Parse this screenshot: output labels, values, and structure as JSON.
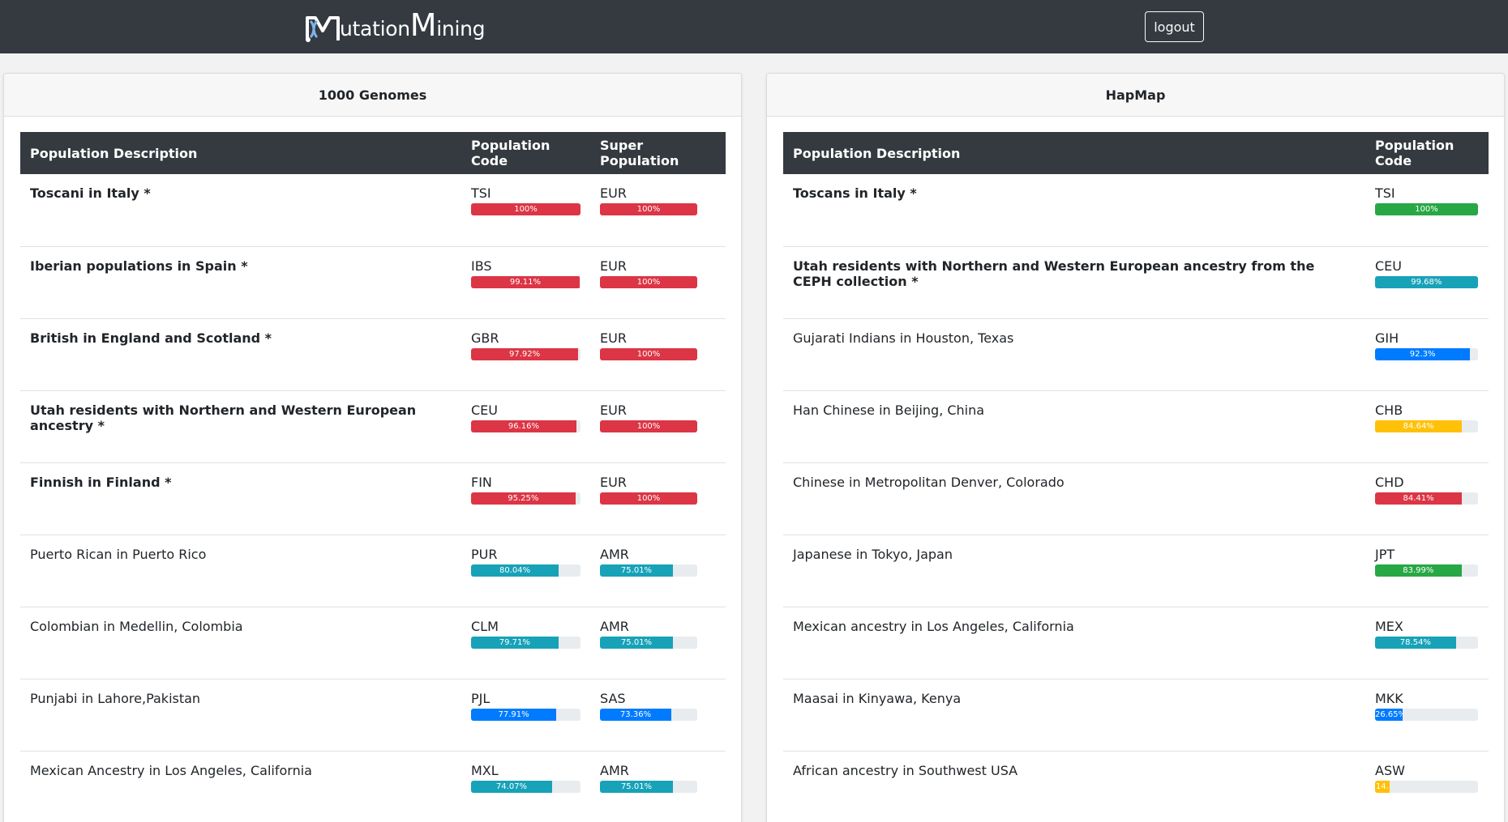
{
  "navbar": {
    "brand_first": "utation",
    "brand_big": "M",
    "brand_second": "ining",
    "logout_label": "logout"
  },
  "colors": {
    "navbar": "#343a40",
    "danger": "#dc3545",
    "info": "#17a2b8",
    "primary": "#007bff",
    "warning": "#ffc107",
    "success": "#28a745"
  },
  "genomes": {
    "title": "1000 Genomes",
    "headers": [
      "Population Description",
      "Population Code",
      "Super Population"
    ],
    "rows": [
      {
        "desc": "Toscani in Italy *",
        "bold": true,
        "code": "TSI",
        "code_pct": 100,
        "code_label": "100%",
        "code_color": "danger",
        "super": "EUR",
        "super_pct": 100,
        "super_label": "100%",
        "super_color": "danger"
      },
      {
        "desc": "Iberian populations in Spain *",
        "bold": true,
        "code": "IBS",
        "code_pct": 99.11,
        "code_label": "99.11%",
        "code_color": "danger",
        "super": "EUR",
        "super_pct": 100,
        "super_label": "100%",
        "super_color": "danger"
      },
      {
        "desc": "British in England and Scotland *",
        "bold": true,
        "code": "GBR",
        "code_pct": 97.92,
        "code_label": "97.92%",
        "code_color": "danger",
        "super": "EUR",
        "super_pct": 100,
        "super_label": "100%",
        "super_color": "danger"
      },
      {
        "desc": "Utah residents with Northern and Western European ancestry *",
        "bold": true,
        "code": "CEU",
        "code_pct": 96.16,
        "code_label": "96.16%",
        "code_color": "danger",
        "super": "EUR",
        "super_pct": 100,
        "super_label": "100%",
        "super_color": "danger"
      },
      {
        "desc": "Finnish in Finland *",
        "bold": true,
        "code": "FIN",
        "code_pct": 95.25,
        "code_label": "95.25%",
        "code_color": "danger",
        "super": "EUR",
        "super_pct": 100,
        "super_label": "100%",
        "super_color": "danger"
      },
      {
        "desc": "Puerto Rican in Puerto Rico",
        "bold": false,
        "code": "PUR",
        "code_pct": 80.04,
        "code_label": "80.04%",
        "code_color": "info",
        "super": "AMR",
        "super_pct": 75.01,
        "super_label": "75.01%",
        "super_color": "info"
      },
      {
        "desc": "Colombian in Medellin, Colombia",
        "bold": false,
        "code": "CLM",
        "code_pct": 79.71,
        "code_label": "79.71%",
        "code_color": "info",
        "super": "AMR",
        "super_pct": 75.01,
        "super_label": "75.01%",
        "super_color": "info"
      },
      {
        "desc": "Punjabi in Lahore,Pakistan",
        "bold": false,
        "code": "PJL",
        "code_pct": 77.91,
        "code_label": "77.91%",
        "code_color": "primary",
        "super": "SAS",
        "super_pct": 73.36,
        "super_label": "73.36%",
        "super_color": "primary"
      },
      {
        "desc": "Mexican Ancestry in Los Angeles, California",
        "bold": false,
        "code": "MXL",
        "code_pct": 74.07,
        "code_label": "74.07%",
        "code_color": "info",
        "super": "AMR",
        "super_pct": 75.01,
        "super_label": "75.01%",
        "super_color": "info"
      }
    ]
  },
  "hapmap": {
    "title": "HapMap",
    "headers": [
      "Population Description",
      "Population Code"
    ],
    "rows": [
      {
        "desc": "Toscans in Italy *",
        "bold": true,
        "code": "TSI",
        "code_pct": 100,
        "code_label": "100%",
        "code_color": "success"
      },
      {
        "desc": "Utah residents with Northern and Western European ancestry from the CEPH collection *",
        "bold": true,
        "code": "CEU",
        "code_pct": 99.68,
        "code_label": "99.68%",
        "code_color": "info"
      },
      {
        "desc": "Gujarati Indians in Houston, Texas",
        "bold": false,
        "code": "GIH",
        "code_pct": 92.3,
        "code_label": "92.3%",
        "code_color": "primary"
      },
      {
        "desc": "Han Chinese in Beijing, China",
        "bold": false,
        "code": "CHB",
        "code_pct": 84.64,
        "code_label": "84.64%",
        "code_color": "warning"
      },
      {
        "desc": "Chinese in Metropolitan Denver, Colorado",
        "bold": false,
        "code": "CHD",
        "code_pct": 84.41,
        "code_label": "84.41%",
        "code_color": "danger"
      },
      {
        "desc": "Japanese in Tokyo, Japan",
        "bold": false,
        "code": "JPT",
        "code_pct": 83.99,
        "code_label": "83.99%",
        "code_color": "success"
      },
      {
        "desc": "Mexican ancestry in Los Angeles, California",
        "bold": false,
        "code": "MEX",
        "code_pct": 78.54,
        "code_label": "78.54%",
        "code_color": "info"
      },
      {
        "desc": "Maasai in Kinyawa, Kenya",
        "bold": false,
        "code": "MKK",
        "code_pct": 26.65,
        "code_label": "26.65%",
        "code_color": "primary"
      },
      {
        "desc": "African ancestry in Southwest USA",
        "bold": false,
        "code": "ASW",
        "code_pct": 14,
        "code_label": "14.",
        "code_color": "warning"
      }
    ]
  }
}
